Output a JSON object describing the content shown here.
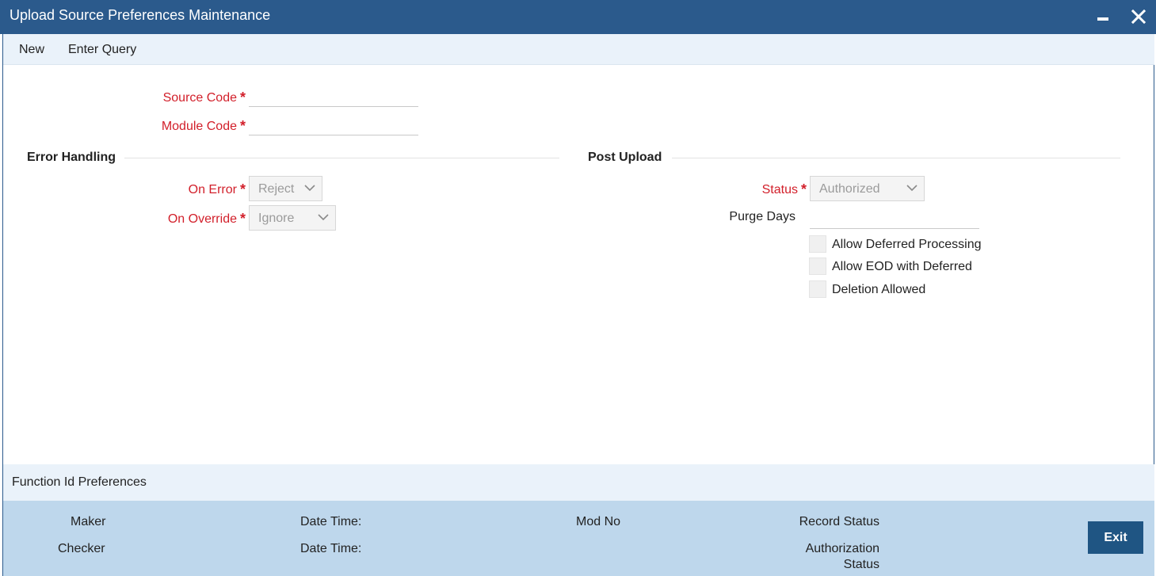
{
  "window": {
    "title": "Upload Source Preferences Maintenance",
    "minimize_icon": "minimize-icon",
    "close_icon": "close-icon"
  },
  "toolbar": {
    "new_label": "New",
    "enter_query_label": "Enter Query"
  },
  "form": {
    "source_code_label": "Source Code",
    "module_code_label": "Module Code",
    "required_marker": "*",
    "source_code_value": "",
    "module_code_value": ""
  },
  "error_handling": {
    "heading": "Error Handling",
    "on_error_label": "On Error",
    "on_error_value": "Reject",
    "on_override_label": "On Override",
    "on_override_value": "Ignore"
  },
  "post_upload": {
    "heading": "Post Upload",
    "status_label": "Status",
    "status_value": "Authorized",
    "purge_days_label": "Purge Days",
    "purge_days_value": "",
    "checkboxes": [
      {
        "label": "Allow Deferred Processing",
        "checked": false
      },
      {
        "label": "Allow EOD with Deferred",
        "checked": false
      },
      {
        "label": "Deletion Allowed",
        "checked": false
      }
    ]
  },
  "subsection": {
    "title": "Function Id Preferences"
  },
  "footer": {
    "maker_label": "Maker",
    "checker_label": "Checker",
    "date_time_label_1": "Date Time:",
    "date_time_label_2": "Date Time:",
    "mod_no_label": "Mod No",
    "record_status_label": "Record Status",
    "authorization_label": "Authorization",
    "status_label": "Status",
    "exit_label": "Exit"
  },
  "colors": {
    "title_bar": "#2b5a8c",
    "required_text": "#d21f2a",
    "toolbar_bg": "#eaf2fa",
    "footer_bg": "#bed7ec",
    "exit_button": "#1f5583"
  }
}
